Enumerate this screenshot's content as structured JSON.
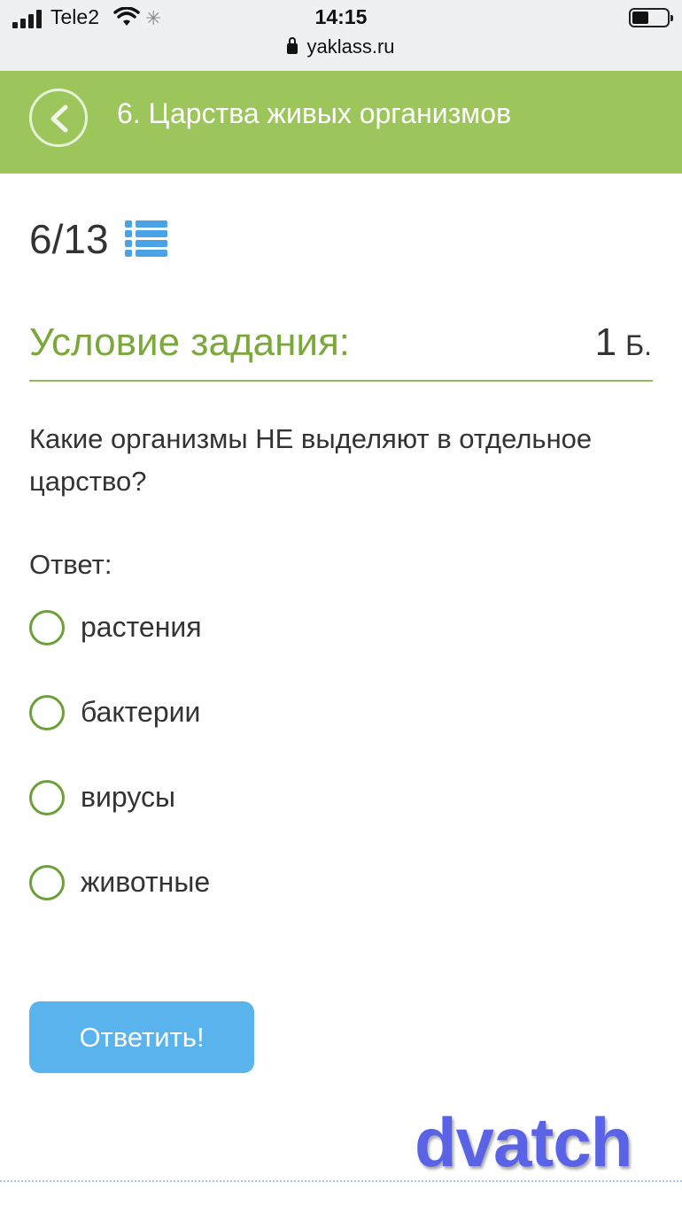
{
  "statusbar": {
    "carrier": "Tele2",
    "time": "14:15",
    "url": "yaklass.ru",
    "icons": [
      "signal-icon",
      "wifi-icon",
      "loading-icon",
      "battery-icon",
      "lock-icon"
    ]
  },
  "header": {
    "title": "6. Царства живых организмов",
    "back_icon": "chevron-left-icon"
  },
  "progress": {
    "counter": "6/13",
    "list_icon": "list-icon"
  },
  "task": {
    "title": "Условие задания:",
    "points": "1",
    "points_unit": "Б.",
    "question": "Какие организмы НЕ выделяют в отдельное царство?",
    "answer_label": "Ответ:",
    "options": [
      {
        "label": "растения",
        "selected": false
      },
      {
        "label": "бактерии",
        "selected": false
      },
      {
        "label": "вирусы",
        "selected": false
      },
      {
        "label": "животные",
        "selected": false
      }
    ],
    "submit_label": "Ответить!"
  },
  "watermark": "dvatch",
  "colors": {
    "header_green": "#9cc55b",
    "title_green": "#7aa83b",
    "radio_green": "#6da039",
    "button_blue": "#59b3ec",
    "icon_blue": "#4aa3e6",
    "watermark_blue": "#5a63e6"
  }
}
